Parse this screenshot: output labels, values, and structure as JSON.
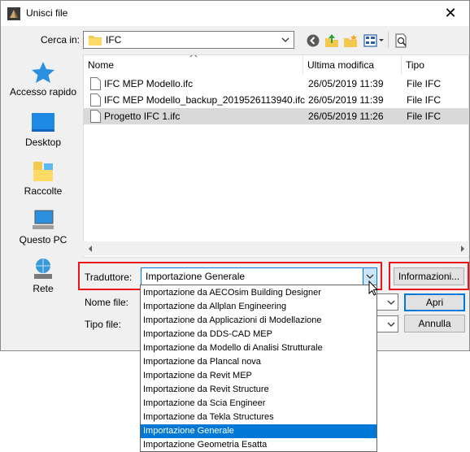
{
  "window": {
    "title": "Unisci file",
    "close_glyph": "✕"
  },
  "lookin": {
    "label": "Cerca in:",
    "value": "IFC"
  },
  "toolbar_icons": [
    "back-icon",
    "up-folder-icon",
    "new-folder-icon",
    "view-menu-icon",
    "preview-icon"
  ],
  "places": [
    {
      "label": "Accesso rapido",
      "icon": "star-icon"
    },
    {
      "label": "Desktop",
      "icon": "desktop-icon"
    },
    {
      "label": "Raccolte",
      "icon": "libraries-icon"
    },
    {
      "label": "Questo PC",
      "icon": "computer-icon"
    },
    {
      "label": "Rete",
      "icon": "network-icon"
    }
  ],
  "file_list": {
    "columns": [
      "Nome",
      "Ultima modifica",
      "Tipo"
    ],
    "rows": [
      {
        "name": "IFC MEP Modello.ifc",
        "modified": "26/05/2019 11:39",
        "type": "File IFC",
        "selected": false
      },
      {
        "name": "IFC MEP Modello_backup_2019526113940.ifc",
        "modified": "26/05/2019 11:39",
        "type": "File IFC",
        "selected": false
      },
      {
        "name": "Progetto IFC 1.ifc",
        "modified": "26/05/2019 11:26",
        "type": "File IFC",
        "selected": true
      }
    ]
  },
  "translator": {
    "label": "Traduttore:",
    "value": "Importazione Generale",
    "info_button": "Informazioni..."
  },
  "filename": {
    "label": "Nome file:"
  },
  "filetype": {
    "label": "Tipo file:"
  },
  "buttons": {
    "open": "Apri",
    "cancel": "Annulla"
  },
  "dropdown_options": [
    "Importazione da AECOsim Building Designer",
    "Importazione da Allplan Engineering",
    "Importazione da Applicazioni di Modellazione",
    "Importazione da DDS-CAD MEP",
    "Importazione da Modello di Analisi Strutturale",
    "Importazione da Plancal nova",
    "Importazione da Revit MEP",
    "Importazione da Revit Structure",
    "Importazione da Scia Engineer",
    "Importazione da Tekla Structures",
    "Importazione Generale",
    "Importazione Geometria Esatta"
  ],
  "dropdown_selected": "Importazione Generale",
  "colors": {
    "highlight_frame": "#e8151b",
    "selection": "#0078d7",
    "dialog_bg": "#f0f0f0"
  }
}
